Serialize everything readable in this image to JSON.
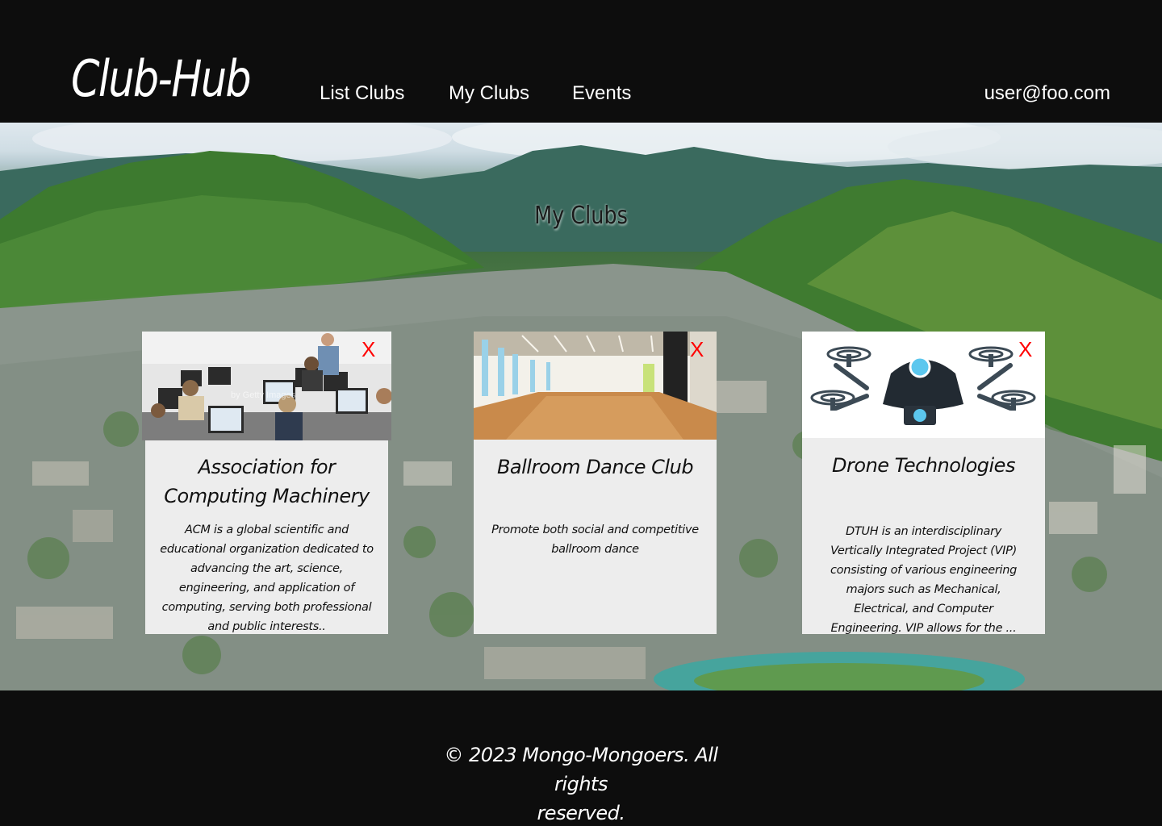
{
  "navbar": {
    "brand": "Club-Hub",
    "links": [
      {
        "label": "List Clubs"
      },
      {
        "label": "My Clubs"
      },
      {
        "label": "Events"
      }
    ],
    "user": "user@foo.com"
  },
  "main": {
    "heading": "My Clubs",
    "remove_label": "X",
    "clubs": [
      {
        "title_line1": "Association for",
        "title_line2": "Computing Machinery",
        "description": "ACM is a global scientific and educational organization dedicated to advancing the art, science, engineering, and application of computing, serving both professional and public interests..",
        "image_icon": "computer-lab-photo",
        "watermark": "by Getty Images"
      },
      {
        "title_line1": "Ballroom Dance Club",
        "description": "Promote both social and competitive ballroom dance",
        "image_icon": "dance-studio-photo"
      },
      {
        "title_line1": "Drone Technologies",
        "description": "DTUH is an interdisciplinary Vertically Integrated Project (VIP) consisting of various engineering majors such as Mechanical, Electrical, and Computer Engineering. VIP allows for the ...",
        "image_icon": "drone-illustration"
      }
    ]
  },
  "footer": {
    "copyright_line1": "© 2023 Mongo-Mongoers. All rights",
    "copyright_line2": "reserved."
  },
  "colors": {
    "background": "#0d0d0d",
    "card": "#ededed",
    "remove": "#ff0000",
    "text_light": "#ffffff"
  }
}
